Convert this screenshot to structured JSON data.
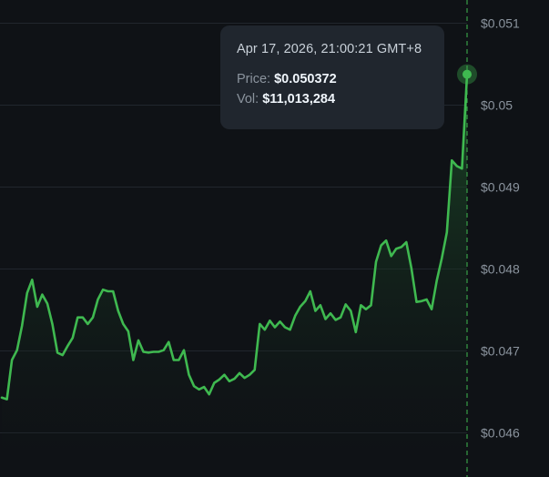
{
  "chart_data": {
    "type": "line",
    "y_ticks": [
      "$0.051",
      "$0.05",
      "$0.049",
      "$0.048",
      "$0.047",
      "$0.046"
    ],
    "y_tick_values": [
      0.051,
      0.05,
      0.049,
      0.048,
      0.047,
      0.046
    ],
    "ylim": [
      0.04545,
      0.05128
    ],
    "grid": "horizontal",
    "colors": {
      "line": "#3fb950",
      "area_top": "#1f5a2c",
      "background": "#0f1216",
      "grid": "#21262d",
      "tooltip_bg": "#20262e"
    },
    "values": [
      0.04642,
      0.0464,
      0.04688,
      0.047,
      0.0473,
      0.0477,
      0.04786,
      0.04753,
      0.04768,
      0.04757,
      0.04732,
      0.04697,
      0.04694,
      0.04705,
      0.04715,
      0.0474,
      0.0474,
      0.04732,
      0.0474,
      0.04762,
      0.04774,
      0.04772,
      0.04772,
      0.04748,
      0.04732,
      0.04723,
      0.04688,
      0.04712,
      0.04698,
      0.04697,
      0.04698,
      0.04698,
      0.047,
      0.0471,
      0.04688,
      0.04688,
      0.047,
      0.0467,
      0.04656,
      0.04652,
      0.04655,
      0.04646,
      0.0466,
      0.04664,
      0.0467,
      0.04662,
      0.04665,
      0.04672,
      0.04666,
      0.0467,
      0.04676,
      0.04732,
      0.04725,
      0.04736,
      0.04728,
      0.04735,
      0.04728,
      0.04725,
      0.04742,
      0.04753,
      0.0476,
      0.04772,
      0.04748,
      0.04755,
      0.04738,
      0.04745,
      0.04737,
      0.0474,
      0.04756,
      0.04748,
      0.04722,
      0.04755,
      0.0475,
      0.04755,
      0.04808,
      0.04828,
      0.04834,
      0.04815,
      0.04824,
      0.04826,
      0.04832,
      0.048,
      0.04759,
      0.0476,
      0.04762,
      0.0475,
      0.04785,
      0.04812,
      0.04844,
      0.04932,
      0.04925,
      0.04922,
      0.05037
    ],
    "highlight": {
      "date": "Apr 17, 2026, 21:00:21 GMT+8",
      "price": 0.050372,
      "volume": 11013284
    }
  },
  "tooltip": {
    "date": "Apr 17, 2026, 21:00:21 GMT+8",
    "price_label": "Price:",
    "price_value": "$0.050372",
    "vol_label": "Vol:",
    "vol_value": "$11,013,284"
  }
}
